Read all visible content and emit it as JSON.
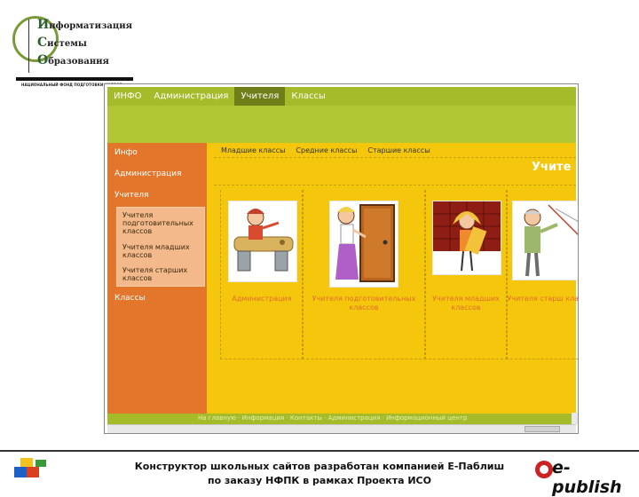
{
  "logo": {
    "words": [
      {
        "initial": "И",
        "rest": "нформатизация"
      },
      {
        "initial": "С",
        "rest": "истемы"
      },
      {
        "initial": "О",
        "rest": "бразования"
      }
    ],
    "subtitle": "НАЦИОНАЛЬНЫЙ ФОНД ПОДГОТОВКИ КАДРОВ"
  },
  "site": {
    "top_nav": [
      {
        "label": "ИНФО",
        "active": false
      },
      {
        "label": "Администрация",
        "active": false
      },
      {
        "label": "Учителя",
        "active": true
      },
      {
        "label": "Классы",
        "active": false
      }
    ],
    "sidebar": {
      "items": [
        "Инфо",
        "Администрация",
        "Учителя",
        "Классы"
      ],
      "submenu": [
        "Учителя подготовительных классов",
        "Учителя младших классов",
        "Учителя старших классов"
      ]
    },
    "class_tabs": [
      "Младшие классы",
      "Средние классы",
      "Старшие классы"
    ],
    "page_title": "Учите",
    "cards": [
      {
        "label": "Администрация"
      },
      {
        "label": "Учителя подготовительных классов"
      },
      {
        "label": "Учителя младших классов"
      },
      {
        "label": "Учителя старш классов"
      }
    ],
    "footer_text": "На главную · Информация · Контакты · Администрация · Информационный центр"
  },
  "caption": {
    "line1": "Конструктор школьных сайтов разработан компанией Е-Паблиш",
    "line2": "по заказу НФПК в рамках Проекта ИСО"
  },
  "brand": {
    "logo_text": "e-publish"
  },
  "colors": {
    "nav_green": "#a5bb2a",
    "sidebar_orange": "#e4762b",
    "content_yellow": "#f4c70d",
    "label_orange": "#e36d2b"
  }
}
